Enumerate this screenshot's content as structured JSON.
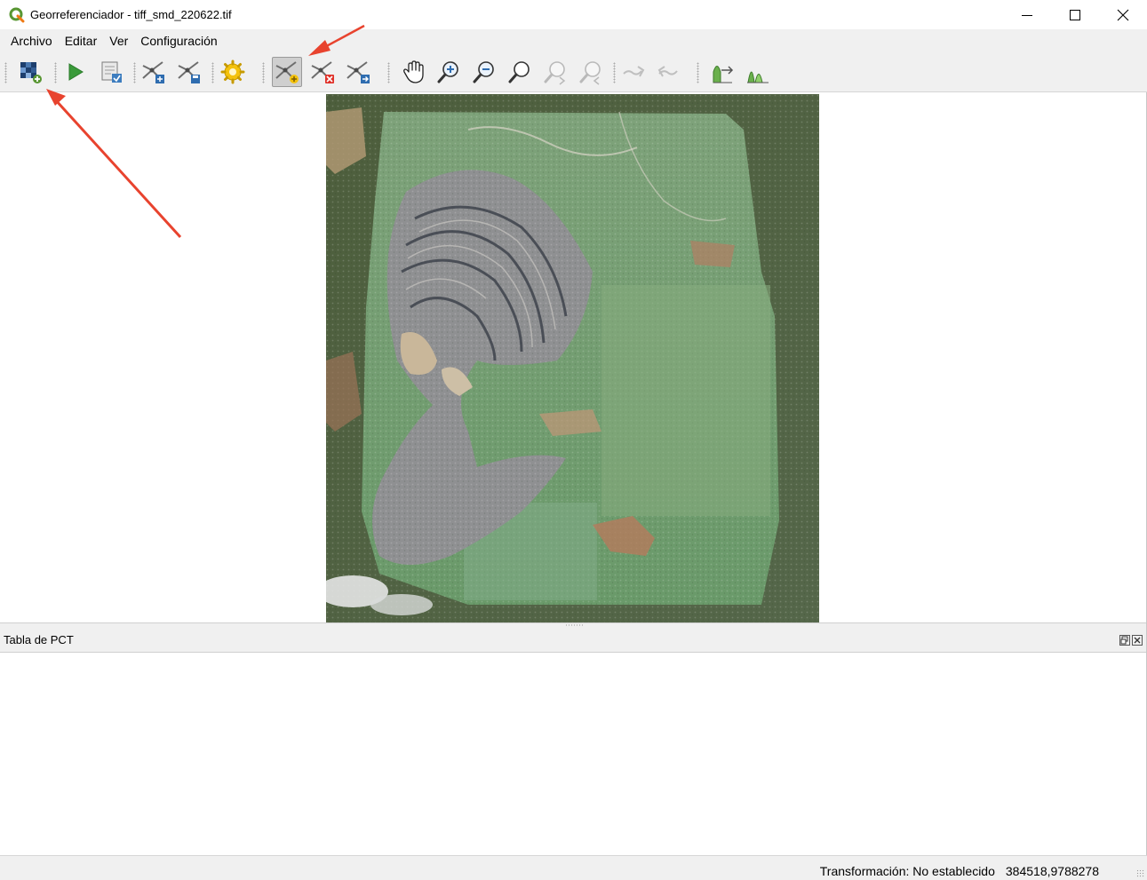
{
  "window": {
    "title": "Georreferenciador - tiff_smd_220622.tif"
  },
  "menubar": {
    "items": [
      "Archivo",
      "Editar",
      "Ver",
      "Configuración"
    ]
  },
  "toolbar": {
    "buttons": [
      {
        "icon": "open-raster-icon"
      },
      {
        "icon": "start-georeferencing-icon"
      },
      {
        "icon": "generate-gdal-script-icon"
      },
      {
        "icon": "load-gcp-points-icon"
      },
      {
        "icon": "save-gcp-points-icon"
      },
      {
        "icon": "transformation-settings-icon"
      },
      {
        "icon": "add-point-icon",
        "active": true
      },
      {
        "icon": "delete-point-icon"
      },
      {
        "icon": "move-gcp-point-icon"
      },
      {
        "icon": "pan-icon"
      },
      {
        "icon": "zoom-in-icon"
      },
      {
        "icon": "zoom-out-icon"
      },
      {
        "icon": "zoom-to-layer-icon"
      },
      {
        "icon": "zoom-last-icon"
      },
      {
        "icon": "zoom-next-icon"
      },
      {
        "icon": "link-georeferencer-icon"
      },
      {
        "icon": "link-qgis-icon"
      },
      {
        "icon": "full-histogram-stretch-icon"
      },
      {
        "icon": "local-histogram-stretch-icon"
      }
    ]
  },
  "gcp_panel": {
    "title": "Tabla de PCT"
  },
  "statusbar": {
    "transform": "Transformación: No establecido",
    "coords": "384518,9788278"
  },
  "colors": {
    "annotation_arrow": "#e8432e",
    "qgis_green": "#589632",
    "window_chrome": "#f0f0f0"
  }
}
